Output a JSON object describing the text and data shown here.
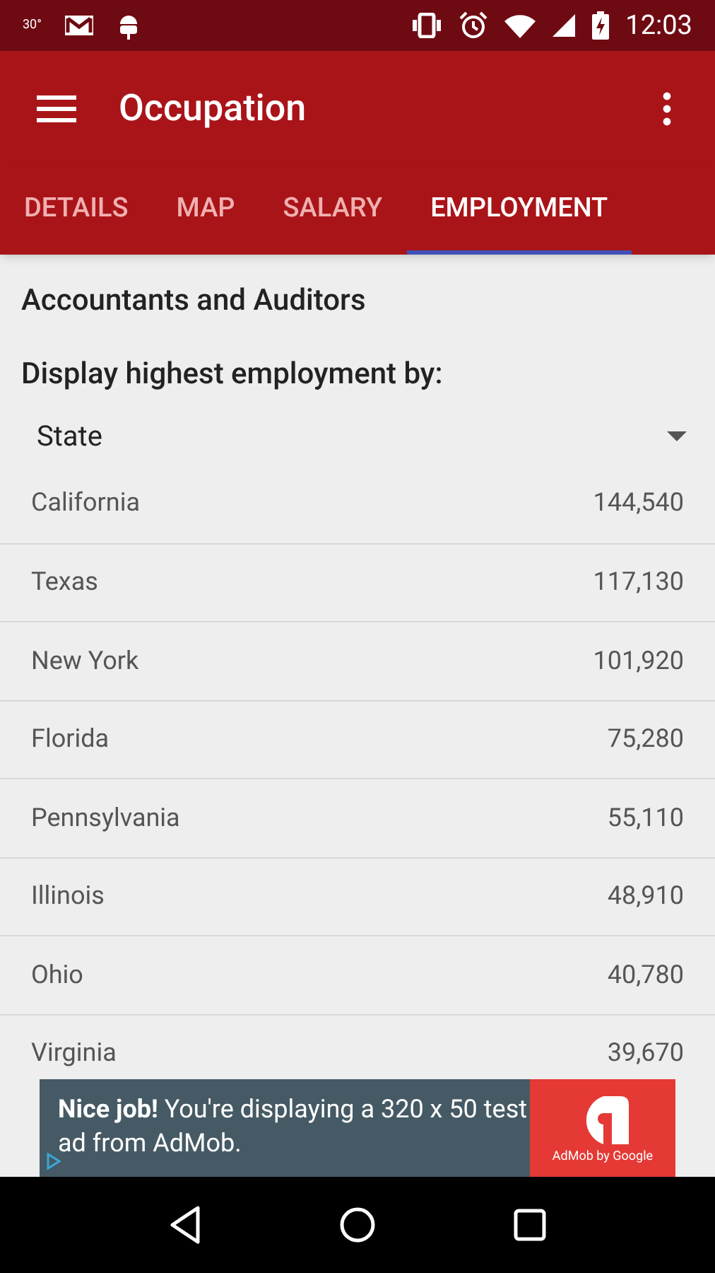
{
  "status_bar": {
    "weather": "30°",
    "time": "12:03"
  },
  "toolbar": {
    "title": "Occupation"
  },
  "tabs": [
    {
      "label": "DETAILS",
      "selected": false
    },
    {
      "label": "MAP",
      "selected": false
    },
    {
      "label": "SALARY",
      "selected": false
    },
    {
      "label": "EMPLOYMENT",
      "selected": true
    }
  ],
  "occupation": "Accountants and Auditors",
  "filter": {
    "label": "Display highest employment by:",
    "value": "State"
  },
  "rows": [
    {
      "name": "California",
      "value": "144,540"
    },
    {
      "name": "Texas",
      "value": "117,130"
    },
    {
      "name": "New York",
      "value": "101,920"
    },
    {
      "name": "Florida",
      "value": "75,280"
    },
    {
      "name": "Pennsylvania",
      "value": "55,110"
    },
    {
      "name": "Illinois",
      "value": "48,910"
    },
    {
      "name": "Ohio",
      "value": "40,780"
    },
    {
      "name": "Virginia",
      "value": "39,670"
    }
  ],
  "ad": {
    "text": "**Nice job!** You're displaying a 320 x 50 test ad from AdMob.",
    "brand": "AdMob by Google"
  }
}
